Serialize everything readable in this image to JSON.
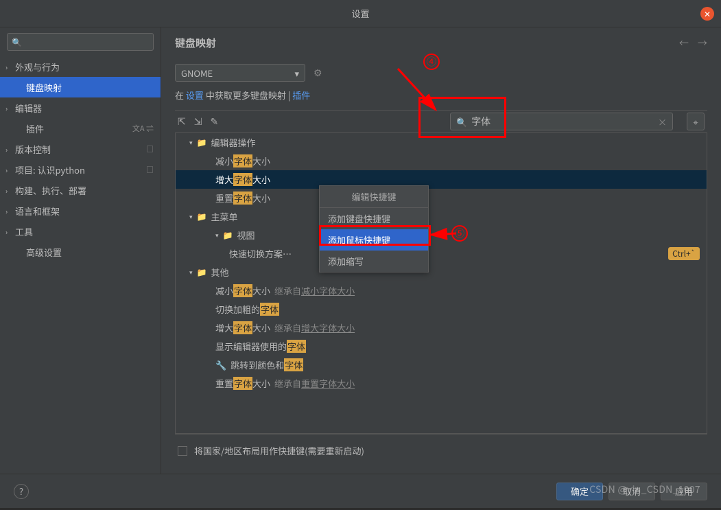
{
  "window": {
    "title": "设置"
  },
  "sidebar": {
    "search_placeholder": "",
    "items": [
      {
        "label": "外观与行为",
        "expandable": true
      },
      {
        "label": "键盘映射",
        "expandable": false,
        "selected": true
      },
      {
        "label": "编辑器",
        "expandable": true
      },
      {
        "label": "插件",
        "expandable": false,
        "badges": "文A ⇌"
      },
      {
        "label": "版本控制",
        "expandable": true,
        "badges": "□"
      },
      {
        "label": "项目: 认识python",
        "expandable": true,
        "badges": "□"
      },
      {
        "label": "构建、执行、部署",
        "expandable": true
      },
      {
        "label": "语言和框架",
        "expandable": true
      },
      {
        "label": "工具",
        "expandable": true
      },
      {
        "label": "高级设置",
        "expandable": false
      }
    ]
  },
  "content": {
    "title": "键盘映射",
    "scheme_selected": "GNOME",
    "link_prefix": "在 ",
    "link_settings": "设置",
    "link_mid": " 中获取更多键盘映射 | ",
    "link_plugins": "插件",
    "filter_value": "字体",
    "tree": {
      "editor_actions": "编辑器操作",
      "decrease_pre": "减小",
      "decrease_hl": "字体",
      "decrease_post": "大小",
      "increase_pre": "增大",
      "increase_hl": "字体",
      "increase_post": "大小",
      "reset_pre": "重置",
      "reset_hl": "字体",
      "reset_post": "大小",
      "main_menu": "主菜单",
      "view": "视图",
      "quick_switch": "快速切换方案…",
      "other": "其他",
      "inherit_from": "继承自 ",
      "inherit_decrease": "减小字体大小",
      "toggle_bold_pre": "切换加粗的",
      "toggle_bold_hl": "字体",
      "inherit_increase": "增大字体大小",
      "show_editor_pre": "显示编辑器使用的",
      "show_editor_hl": "字体",
      "jump_pre": "跳转到颜色和",
      "jump_hl": "字体",
      "inherit_reset": "重置字体大小",
      "shortcut_ctrl_backtick": "Ctrl+`"
    },
    "context_menu": {
      "header": "编辑快捷键",
      "add_keyboard": "添加键盘快捷键",
      "add_mouse": "添加鼠标快捷键",
      "add_abbrev": "添加缩写"
    },
    "checkbox_label": "将国家/地区布局用作快捷键(需要重新启动)"
  },
  "footer": {
    "ok": "确定",
    "cancel": "取消",
    "apply": "应用"
  },
  "annotations": {
    "step4": "④",
    "step5": "⑤"
  },
  "watermark": "CSDN @yin_CSDN_1007"
}
